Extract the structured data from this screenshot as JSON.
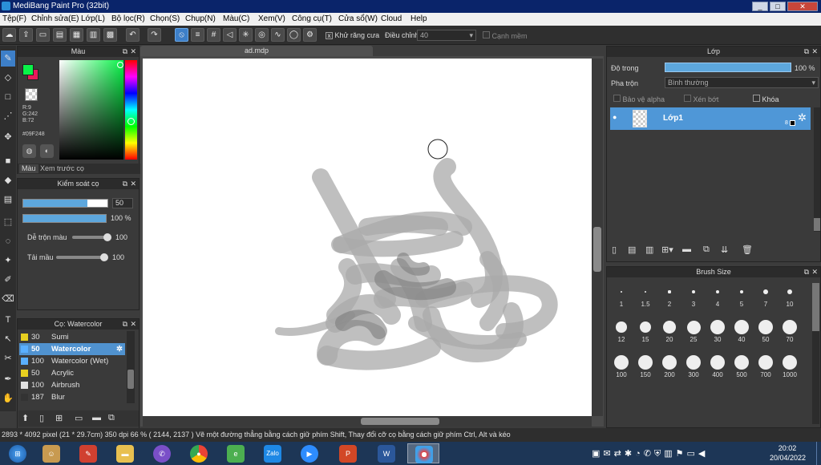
{
  "window": {
    "title": "MediBang Paint Pro (32bit)"
  },
  "menu": [
    "Tệp(F)",
    "Chỉnh sửa(E)",
    "Lớp(L)",
    "Bộ lọc(R)",
    "Chọn(S)",
    "Chụp(N)",
    "Màu(C)",
    "Xem(V)",
    "Công cụ(T)",
    "Cửa sổ(W)",
    "Cloud",
    "Help"
  ],
  "toolbar": {
    "antialias_label": "Khử răng cưa",
    "adjust_label": "Điều chỉnh",
    "adjust_value": "40",
    "edge_label": "Cạnh mềm",
    "antialias_checked": "x"
  },
  "color_panel": {
    "title": "Màu",
    "r": "R:9",
    "g": "G:242",
    "b": "B:72",
    "hex": "#09F248",
    "tab_color": "Màu",
    "tab_preview": "Xem trước cọ",
    "fg_color": "#09F248",
    "bg_color": "#E8185A"
  },
  "brush_control": {
    "title": "Kiểm soát cọ",
    "size_value": "50",
    "size_fraction": 0.76,
    "opacity_value": "100 %",
    "opacity_fraction": 1.0,
    "blend_label": "Dễ trộn màu",
    "blend_value": "100",
    "blend_fraction": 1.0,
    "ink_label": "Tải mầu",
    "ink_value": "100",
    "ink_fraction": 1.0
  },
  "brush_list": {
    "title": "Cọ: Watercolor",
    "items": [
      {
        "size": "30",
        "name": "Sumi",
        "color": "#e8d020"
      },
      {
        "size": "50",
        "name": "Watercolor",
        "color": "#5ab0ff",
        "selected": true
      },
      {
        "size": "100",
        "name": "Watercolor (Wet)",
        "color": "#5ab0ff"
      },
      {
        "size": "50",
        "name": "Acrylic",
        "color": "#e8d020"
      },
      {
        "size": "100",
        "name": "Airbrush",
        "color": "#e0e0e0"
      },
      {
        "size": "187",
        "name": "Blur",
        "color": "#333333"
      }
    ]
  },
  "document": {
    "tab_title": "ad.mdp"
  },
  "layer_panel": {
    "title": "Lớp",
    "opacity_label": "Độ trong",
    "opacity_value": "100 %",
    "opacity_fraction": 1.0,
    "blend_label": "Pha trộn",
    "blend_value": "Bình thường",
    "protect_alpha": "Bảo vệ alpha",
    "clipping": "Xén bớt",
    "lock": "Khóa",
    "layer_name": "Lớp1",
    "layer_badge": "8"
  },
  "brush_size": {
    "title": "Brush Size",
    "sizes": [
      "1",
      "1.5",
      "2",
      "3",
      "4",
      "5",
      "7",
      "10",
      "12",
      "15",
      "20",
      "25",
      "30",
      "40",
      "50",
      "70",
      "100",
      "150",
      "200",
      "300",
      "400",
      "500",
      "700",
      "1000"
    ]
  },
  "status": {
    "text": "2893 * 4092 pixel   (21 * 29.7cm)   350 dpi   66 %   ( 2144, 2137 )   Vẽ một đường thẳng bằng cách giữ phím Shift, Thay đổi cỡ cọ bằng cách giữ phím Ctrl, Alt và kéo"
  },
  "taskbar": {
    "apps": [
      "start",
      "explorer-user",
      "paint",
      "folder",
      "viber",
      "chrome",
      "edge",
      "zalo",
      "zoom",
      "powerpoint",
      "word",
      "medibang"
    ],
    "zalo_label": "Zalo",
    "time": "20:02",
    "date": "20/04/2022"
  }
}
